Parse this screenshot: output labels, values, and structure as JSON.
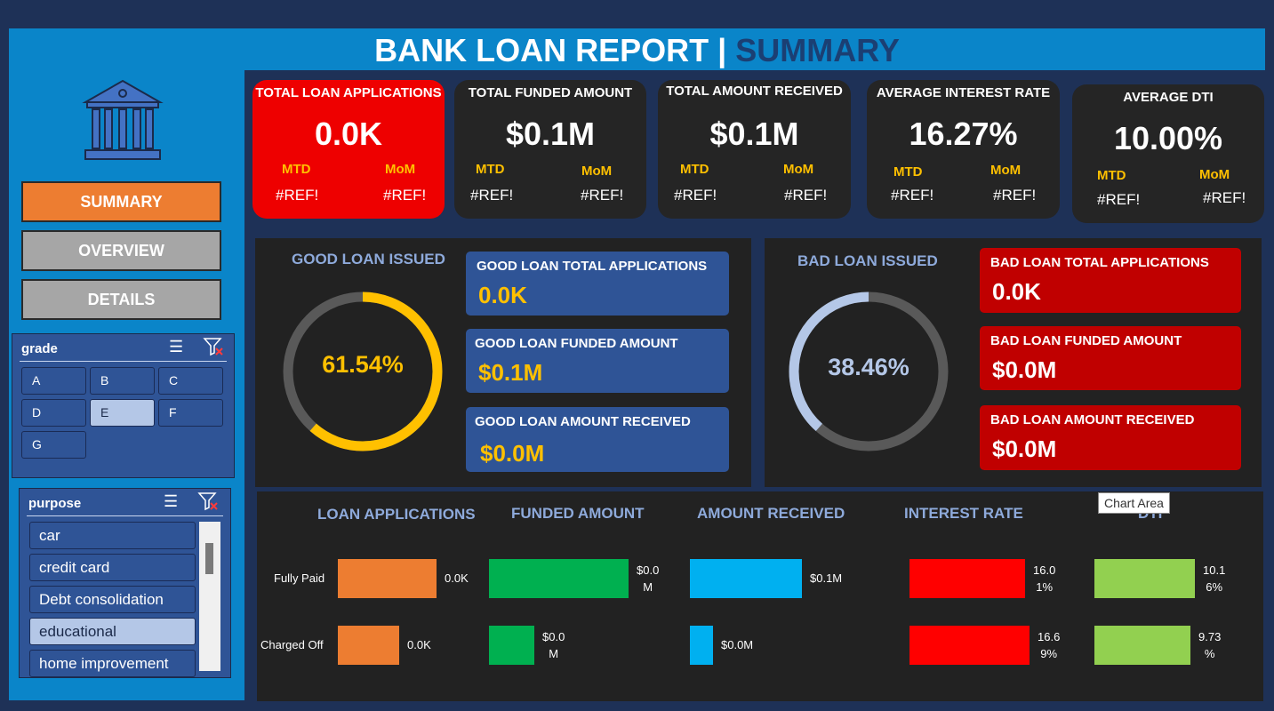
{
  "header": {
    "title_main": "BANK LOAN REPORT",
    "separator": "|",
    "title_sub": "SUMMARY"
  },
  "nav": {
    "summary": "SUMMARY",
    "overview": "OVERVIEW",
    "details": "DETAILS"
  },
  "slicers": {
    "grade": {
      "label": "grade",
      "options": [
        "A",
        "B",
        "C",
        "D",
        "E",
        "F",
        "G"
      ],
      "selected": "E"
    },
    "purpose": {
      "label": "purpose",
      "options": [
        "car",
        "credit card",
        "Debt consolidation",
        "educational",
        "home improvement"
      ],
      "selected": "educational"
    }
  },
  "kpis": [
    {
      "title": "TOTAL LOAN APPLICATIONS",
      "value": "0.0K",
      "mtd_label": "MTD",
      "mom_label": "MoM",
      "mtd": "#REF!",
      "mom": "#REF!"
    },
    {
      "title": "TOTAL FUNDED AMOUNT",
      "value": "$0.1M",
      "mtd_label": "MTD",
      "mom_label": "MoM",
      "mtd": "#REF!",
      "mom": "#REF!"
    },
    {
      "title": "TOTAL AMOUNT RECEIVED",
      "value": "$0.1M",
      "mtd_label": "MTD",
      "mom_label": "MoM",
      "mtd": "#REF!",
      "mom": "#REF!"
    },
    {
      "title": "AVERAGE INTEREST RATE",
      "value": "16.27%",
      "mtd_label": "MTD",
      "mom_label": "MoM",
      "mtd": "#REF!",
      "mom": "#REF!"
    },
    {
      "title": "AVERAGE DTI",
      "value": "10.00%",
      "mtd_label": "MTD",
      "mom_label": "MoM",
      "mtd": "#REF!",
      "mom": "#REF!"
    }
  ],
  "good_loan": {
    "title": "GOOD LOAN ISSUED",
    "percent_label": "61.54%",
    "percent": 61.54,
    "apps_title": "GOOD LOAN TOTAL APPLICATIONS",
    "apps_value": "0.0K",
    "funded_title": "GOOD LOAN FUNDED AMOUNT",
    "funded_value": "$0.1M",
    "received_title": "GOOD LOAN AMOUNT RECEIVED",
    "received_value": "$0.0M"
  },
  "bad_loan": {
    "title": "BAD LOAN ISSUED",
    "percent_label": "38.46%",
    "percent": 38.46,
    "apps_title": "BAD LOAN TOTAL APPLICATIONS",
    "apps_value": "0.0K",
    "funded_title": "BAD LOAN FUNDED AMOUNT",
    "funded_value": "$0.0M",
    "received_title": "BAD LOAN AMOUNT RECEIVED",
    "received_value": "$0.0M"
  },
  "colors": {
    "gauge_good": "#ffc000",
    "gauge_bad": "#b4c7e7",
    "gauge_track": "#595959",
    "loan_apps": "#ed7d31",
    "funded": "#00b050",
    "received": "#00b0f0",
    "interest": "#ff0000",
    "dti": "#92d050"
  },
  "tooltip": "Chart Area",
  "chart_data": [
    {
      "type": "bar",
      "title": "LOAN APPLICATIONS",
      "categories": [
        "Fully Paid",
        "Charged Off"
      ],
      "values": [
        8,
        5
      ],
      "data_labels": [
        "0.0K",
        "0.0K"
      ]
    },
    {
      "type": "bar",
      "title": "FUNDED AMOUNT",
      "categories": [
        "Fully Paid",
        "Charged Off"
      ],
      "values": [
        0.04,
        0.013
      ],
      "data_labels": [
        "$0.0 M",
        "$0.0 M"
      ]
    },
    {
      "type": "bar",
      "title": "AMOUNT RECEIVED",
      "categories": [
        "Fully Paid",
        "Charged Off"
      ],
      "values": [
        0.053,
        0.011
      ],
      "data_labels": [
        "$0.1M",
        "$0.0M"
      ]
    },
    {
      "type": "bar",
      "title": "INTEREST RATE",
      "categories": [
        "Fully Paid",
        "Charged Off"
      ],
      "values": [
        16.01,
        16.69
      ],
      "data_labels": [
        "16.0 1%",
        "16.6 9%"
      ]
    },
    {
      "type": "bar",
      "title": "DTI",
      "categories": [
        "Fully Paid",
        "Charged Off"
      ],
      "values": [
        10.16,
        9.73
      ],
      "data_labels": [
        "10.1 6%",
        "9.73 %"
      ]
    }
  ]
}
